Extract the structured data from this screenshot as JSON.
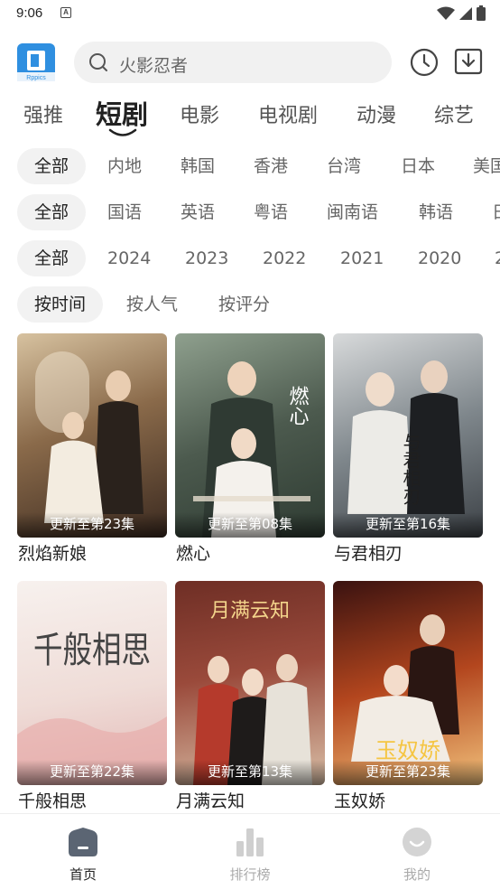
{
  "status_bar": {
    "time": "9:06",
    "notif_icon": "A"
  },
  "header": {
    "search_placeholder": "火影忍者",
    "logo_text": "Rppics"
  },
  "tabs": [
    {
      "label": "强推"
    },
    {
      "label": "短剧"
    },
    {
      "label": "电影"
    },
    {
      "label": "电视剧"
    },
    {
      "label": "动漫"
    },
    {
      "label": "综艺"
    }
  ],
  "filters": {
    "region": [
      "全部",
      "内地",
      "韩国",
      "香港",
      "台湾",
      "日本",
      "美国"
    ],
    "language": [
      "全部",
      "国语",
      "英语",
      "粤语",
      "闽南语",
      "韩语",
      "日"
    ],
    "year": [
      "全部",
      "2024",
      "2023",
      "2022",
      "2021",
      "2020",
      "2"
    ],
    "sort": [
      "按时间",
      "按人气",
      "按评分"
    ]
  },
  "cards": [
    {
      "title": "烈焰新娘",
      "badge": "更新至第23集",
      "poster_title": "",
      "tone": [
        "#3b2a20",
        "#8a6a4a",
        "#d7c2a0"
      ]
    },
    {
      "title": "燃心",
      "badge": "更新至第08集",
      "poster_title": "燃心",
      "tone": [
        "#2e3b32",
        "#6d7a6a",
        "#e5dccd"
      ]
    },
    {
      "title": "与君相刃",
      "badge": "更新至第16集",
      "poster_title": "与君相刃",
      "tone": [
        "#3c4146",
        "#7f878c",
        "#d8dadb"
      ]
    },
    {
      "title": "千般相思",
      "badge": "更新至第22集",
      "poster_title": "千般相思",
      "tone": [
        "#f0e4e0",
        "#e2b7b5",
        "#f7f1ee"
      ]
    },
    {
      "title": "月满云知",
      "badge": "更新至第13集",
      "poster_title": "月满云知",
      "tone": [
        "#5b2a24",
        "#9a4a3b",
        "#d9bfa7"
      ]
    },
    {
      "title": "玉奴娇",
      "badge": "更新至第23集",
      "poster_title": "玉奴娇",
      "tone": [
        "#5a1a12",
        "#b3461e",
        "#f1c07a"
      ]
    }
  ],
  "bottom_nav": [
    {
      "label": "首页",
      "icon": "home-icon",
      "active": true
    },
    {
      "label": "排行榜",
      "icon": "ranking-icon",
      "active": false
    },
    {
      "label": "我的",
      "icon": "profile-icon",
      "active": false
    }
  ],
  "colors": {
    "accent_blue": "#2f8fe0",
    "chip_bg": "#f2f2f2",
    "text_muted": "#666666"
  }
}
